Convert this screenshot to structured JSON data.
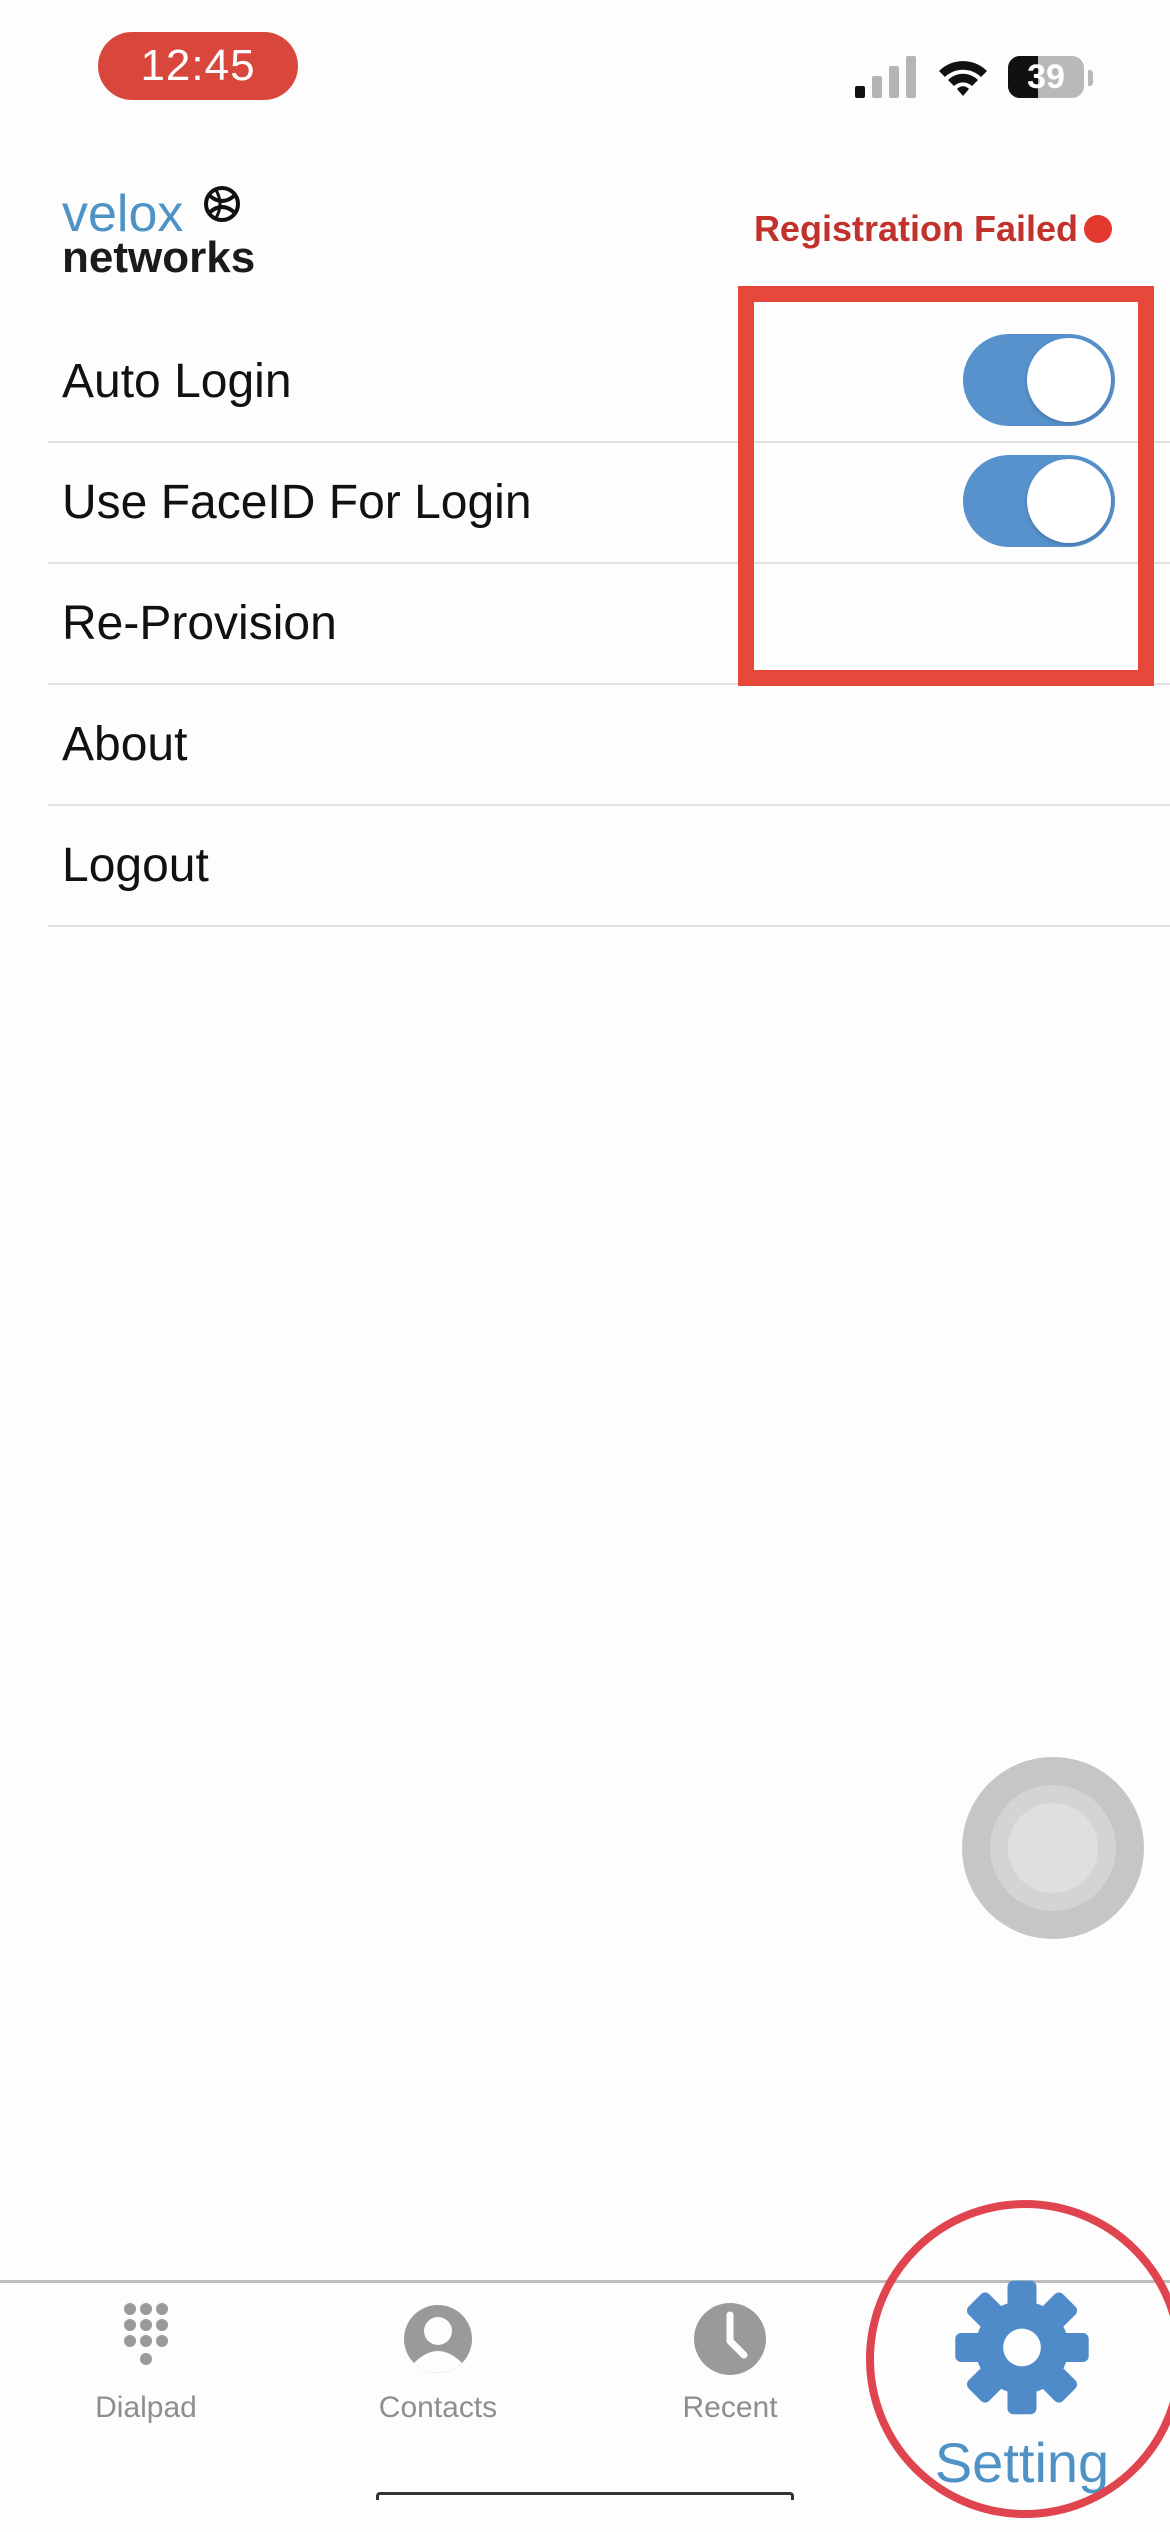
{
  "status_bar": {
    "time": "12:45",
    "battery": "39",
    "battery_level": 0.39
  },
  "header": {
    "logo_line1": "velox",
    "logo_line2": "networks",
    "registration_status": "Registration Failed"
  },
  "settings": {
    "items": [
      {
        "label": "Auto Login",
        "toggle": true,
        "enabled": true
      },
      {
        "label": "Use FaceID For Login",
        "toggle": true,
        "enabled": true
      },
      {
        "label": "Re-Provision",
        "toggle": false
      },
      {
        "label": "About",
        "toggle": false
      },
      {
        "label": "Logout",
        "toggle": false
      }
    ]
  },
  "tab_bar": {
    "tabs": [
      {
        "label": "Dialpad",
        "icon": "dialpad-icon"
      },
      {
        "label": "Contacts",
        "icon": "contacts-icon"
      },
      {
        "label": "Recent",
        "icon": "clock-icon"
      },
      {
        "label": "Setting",
        "icon": "gear-icon",
        "active": true
      }
    ]
  },
  "colors": {
    "accent": "#5792cd",
    "error": "#c0322b",
    "annotation": "#e8473c"
  }
}
